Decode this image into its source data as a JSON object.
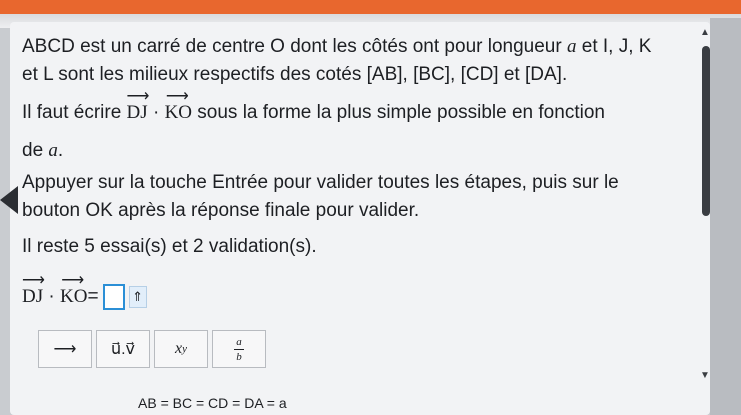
{
  "problem": {
    "line1": "ABCD est un carré de centre O dont les côtés ont pour longueur ",
    "var_a": "a",
    "line1_end": " et I, J, K",
    "line2": "et L sont les milieux respectifs des cotés [AB], [BC], [CD] et [DA].",
    "line3_start": "Il faut écrire ",
    "vec1": "DJ",
    "dot": " · ",
    "vec2": "KO",
    "line3_end": " sous la forme la plus simple possible en fonction",
    "line4": "de ",
    "line4_var": "a",
    "line4_end": "."
  },
  "instructions": {
    "line1": "Appuyer sur la touche Entrée pour valider toutes les étapes, puis sur le",
    "line2": "bouton OK après la réponse finale pour valider.",
    "attempts": "Il reste 5 essai(s) et 2 validation(s)."
  },
  "answer": {
    "vec1": "DJ",
    "dot": " · ",
    "vec2": "KO",
    "equals": "=",
    "hat_icon": "⇑"
  },
  "toolbar": {
    "arrow_label": "⟶",
    "uv_label": "u⃗.v⃗",
    "power_base": "x",
    "power_exp": "y",
    "frac_num": "a",
    "frac_den": "b"
  },
  "bottom": {
    "equation": "AB = BC = CD = DA = a"
  },
  "colors": {
    "topbar": "#e8672e",
    "input_border": "#2b8fd6"
  }
}
